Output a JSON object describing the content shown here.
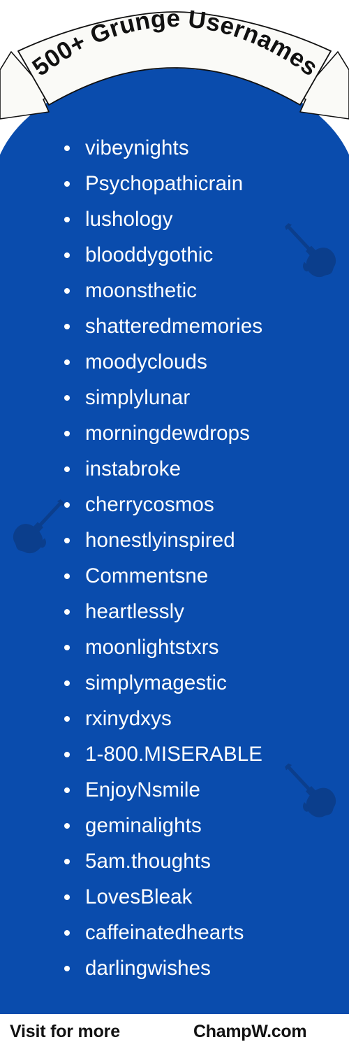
{
  "banner": {
    "title": "500+ Grunge Usernames"
  },
  "colors": {
    "background": "#ffffff",
    "panel_blue": "#0A4CAD",
    "guitar_blue": "#0B3E8C",
    "text_white": "#ffffff",
    "footer_text": "#111111",
    "ribbon_fill": "#FAFAF7",
    "ribbon_stroke": "#111111"
  },
  "list": {
    "items": [
      "vibeynights",
      "Psychopathicrain",
      "lushology",
      "blooddygothic",
      "moonsthetic",
      "shatteredmemories",
      "moodyclouds",
      "simplylunar",
      "morningdewdrops",
      "instabroke",
      "cherrycosmos",
      "honestlyinspired",
      "Commentsne",
      "heartlessly",
      "moonlightstxrs",
      "simplymagestic",
      "rxinydxys",
      "1-800.MISERABLE",
      "EnjoyNsmile",
      "geminalights",
      "5am.thoughts",
      "LovesBleak",
      "caffeinatedhearts",
      "darlingwishes"
    ]
  },
  "decorations": {
    "guitar_icon_name": "electric-guitar-silhouette",
    "count": 3
  },
  "footer": {
    "visit_label": "Visit for more",
    "brand_label": "ChampW.com"
  }
}
